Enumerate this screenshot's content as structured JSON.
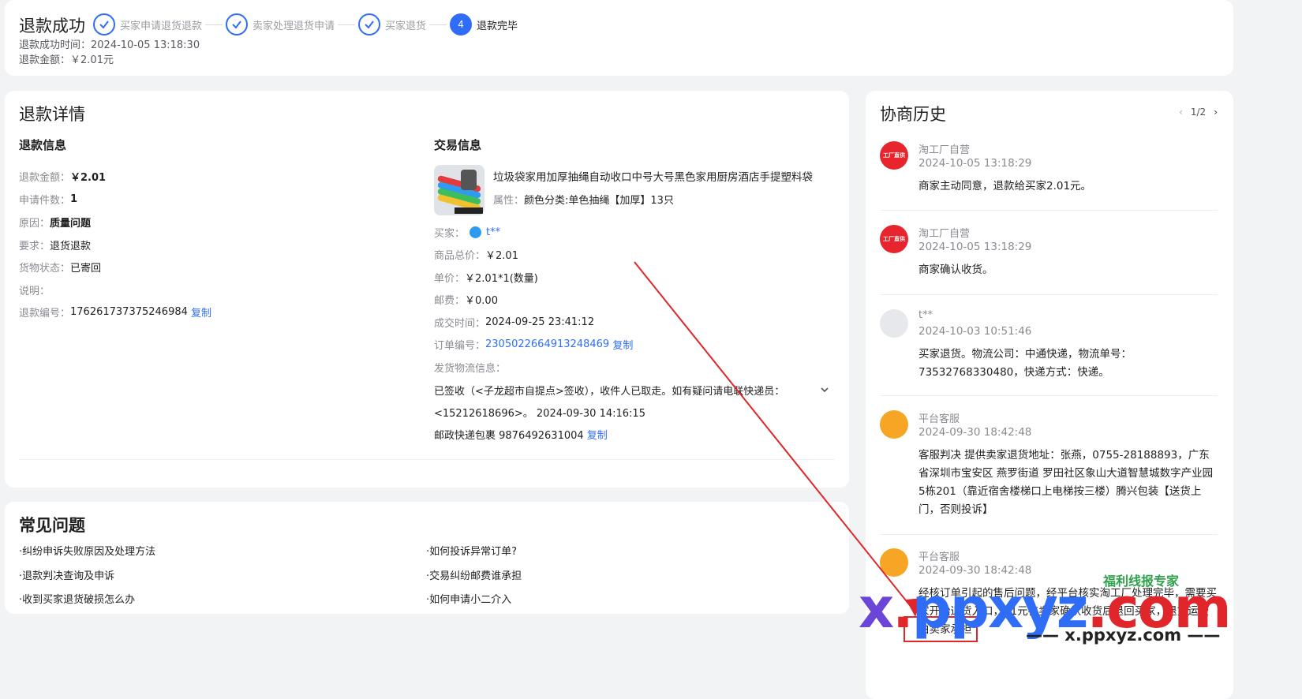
{
  "status": {
    "title": "退款成功",
    "steps": [
      {
        "label": "买家申请退货退款",
        "state": "done"
      },
      {
        "label": "卖家处理退货申请",
        "state": "done"
      },
      {
        "label": "买家退货",
        "state": "done"
      },
      {
        "label": "退款完毕",
        "state": "active",
        "number": "4"
      }
    ],
    "success_time_label": "退款成功时间：",
    "success_time": "2024-10-05 13:18:30",
    "amount_label": "退款金额：",
    "amount": "￥2.01元"
  },
  "detail": {
    "title": "退款详情",
    "refund_info": {
      "title": "退款信息",
      "rows": [
        {
          "k": "退款金额：",
          "v": "￥2.01",
          "bold": true
        },
        {
          "k": "申请件数：",
          "v": "1",
          "bold": true
        },
        {
          "k": "原因：",
          "v": "质量问题",
          "bold": true
        },
        {
          "k": "要求：",
          "v": "退货退款",
          "bold": false
        },
        {
          "k": "货物状态：",
          "v": "已寄回",
          "bold": false
        },
        {
          "k": "说明：",
          "v": "",
          "bold": false
        },
        {
          "k": "退款编号：",
          "v": "176261737375246984",
          "bold": false
        }
      ],
      "copy": "复制"
    },
    "trade_info": {
      "title": "交易信息",
      "product_title": "垃圾袋家用加厚抽绳自动收口中号大号黑色家用厨房酒店手提塑料袋",
      "attr_label": "属性：",
      "attr_value": "颜色分类:单色抽绳【加厚】13只",
      "buyer_label": "买家：",
      "buyer": "t**",
      "total_label": "商品总价：",
      "total": "￥2.01",
      "unit_label": "单价：",
      "unit": "￥2.01*1(数量)",
      "postage_label": "邮费：",
      "postage": "￥0.00",
      "deal_time_label": "成交时间：",
      "deal_time": "2024-09-25 23:41:12",
      "order_label": "订单编号：",
      "order_no": "2305022664913248469",
      "copy": "复制",
      "shipping_label": "发货物流信息：",
      "shipping_text": "已签收（<子龙超市自提点>签收），收件人已取走。如有疑问请电联快递员：<15212618696>。 2024-09-30 14:16:15",
      "express": "邮政快递包裹 9876492631004",
      "express_copy": "复制"
    }
  },
  "faq": {
    "title": "常见问题",
    "left": [
      "·纠纷申诉失败原因及处理方法",
      "·退款判决查询及申诉",
      "·收到买家退货破损怎么办"
    ],
    "right": [
      "·如何投诉异常订单?",
      "·交易纠纷邮费谁承担",
      "·如何申请小二介入"
    ]
  },
  "history": {
    "title": "协商历史",
    "pager": {
      "prev": "‹",
      "page": "1/2",
      "next": "›"
    },
    "entries": [
      {
        "who": "淘工厂自营",
        "time": "2024-10-05 13:18:29",
        "msg": "商家主动同意，退款给买家2.01元。",
        "avatar": "shop"
      },
      {
        "who": "淘工厂自营",
        "time": "2024-10-05 13:18:29",
        "msg": "商家确认收货。",
        "avatar": "shop"
      },
      {
        "who": "t**",
        "time": "2024-10-03 10:51:46",
        "msg": "买家退货。物流公司：中通快递，物流单号：73532768330480，快递方式：快递。",
        "avatar": "user"
      },
      {
        "who": "平台客服",
        "time": "2024-09-30 18:42:48",
        "msg": "客服判决 提供卖家退货地址：张燕，0755-28188893，广东省深圳市宝安区 燕罗街道  罗田社区象山大道智慧城数字产业园5栋201（靠近宿舍楼梯口上电梯按三楼）腾兴包装【送货上门，否则投诉】",
        "avatar": "cs"
      },
      {
        "who": "平台客服",
        "time": "2024-09-30 18:42:48",
        "msg": "经核订单引起的售后问题，经平台核实淘工厂处理完毕，需要买家开始退货入口，01元在卖家确认收货后退回买家，退货运费由卖家承担",
        "avatar": "cs"
      }
    ],
    "shop_avatar_text": "工厂直供"
  },
  "watermark": {
    "logo": "x.ppxyz.com",
    "sub": "—— x.ppxyz.com ——",
    "top": "福利线报专家"
  }
}
